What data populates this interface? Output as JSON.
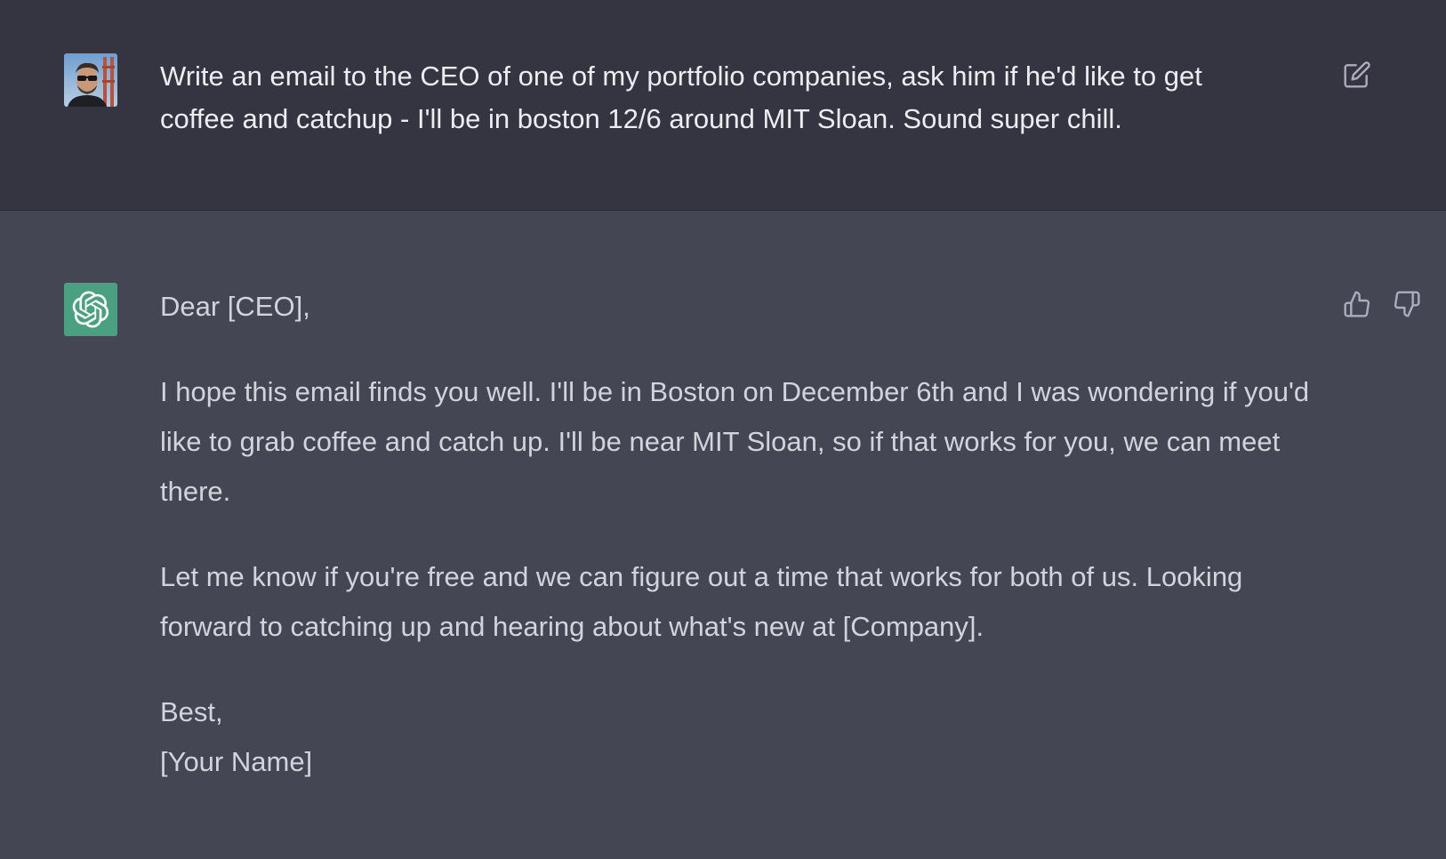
{
  "user_message": {
    "text": "Write an email to the CEO of one of my portfolio companies, ask him if he'd like to get coffee and catchup - I'll be in boston 12/6 around MIT Sloan. Sound super chill."
  },
  "assistant_message": {
    "greeting": "Dear [CEO],",
    "body_1": "I hope this email finds you well. I'll be in Boston on December 6th and I was wondering if you'd like to grab coffee and catch up. I'll be near MIT Sloan, so if that works for you, we can meet there.",
    "body_2": "Let me know if you're free and we can figure out a time that works for both of us. Looking forward to catching up and hearing about what's new at [Company].",
    "signoff": "Best,",
    "signature": "[Your Name]"
  },
  "icons": {
    "user_avatar": "user-avatar-photo",
    "assistant_avatar": "openai-logo-icon",
    "edit": "edit-icon",
    "thumbs_up": "thumbs-up-icon",
    "thumbs_down": "thumbs-down-icon"
  },
  "colors": {
    "user_bg": "#343541",
    "assistant_bg": "#444654",
    "assistant_avatar_bg": "#4aa181",
    "user_text": "#ececf1",
    "assistant_text": "#d1d5db",
    "icon": "#acacbe"
  }
}
